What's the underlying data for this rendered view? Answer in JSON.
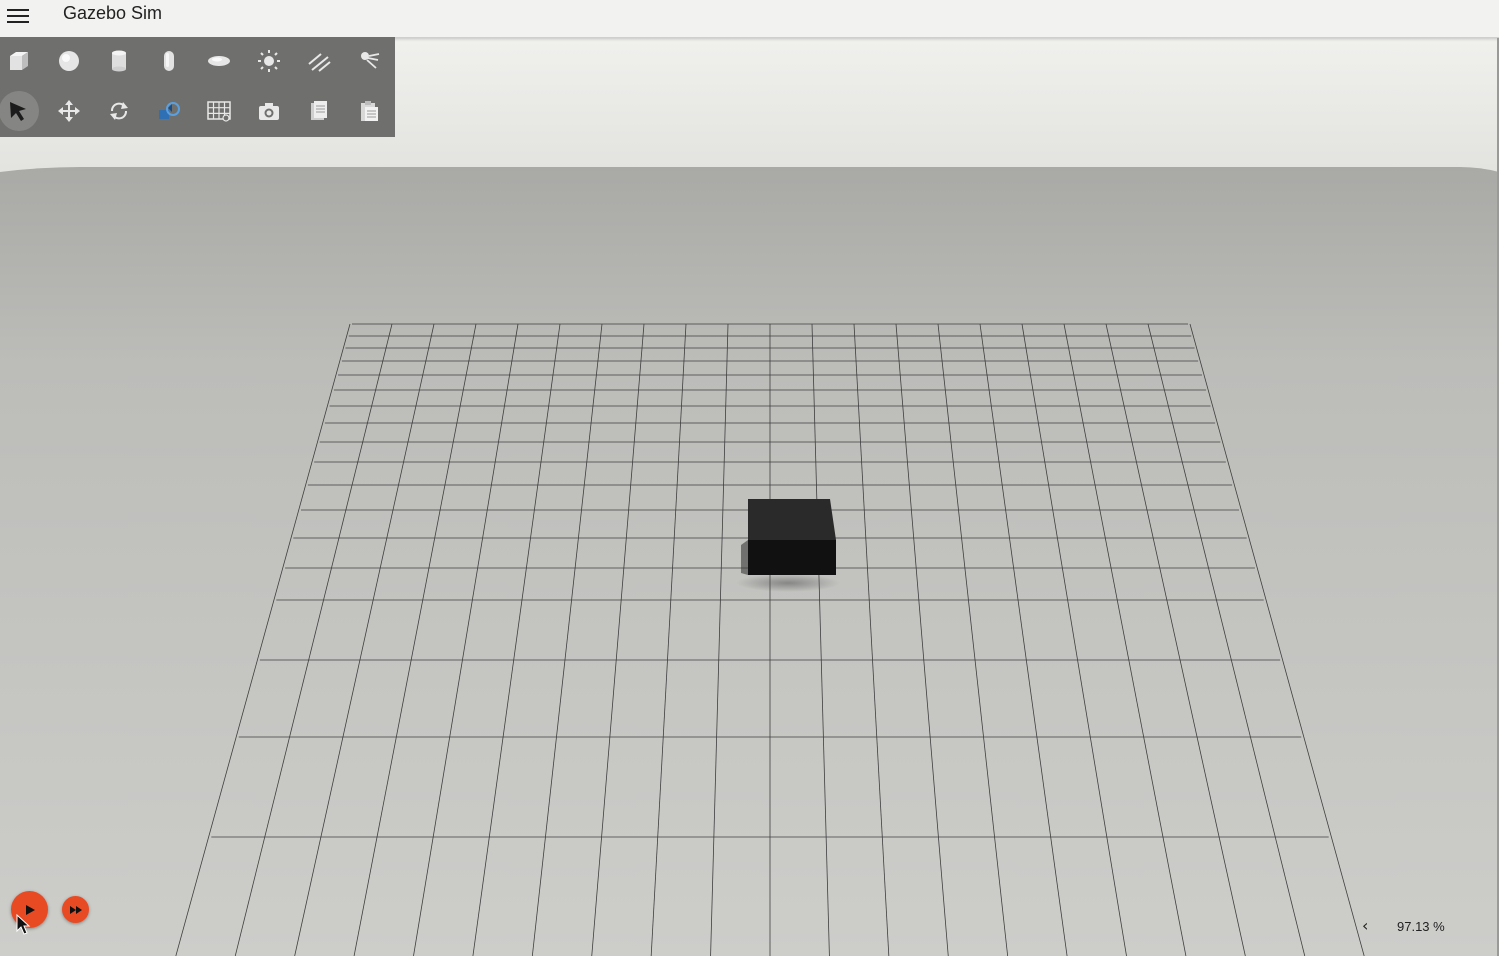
{
  "window": {
    "title": "Gazebo Sim"
  },
  "toolbar": {
    "row1": [
      {
        "icon": "box-shape-icon"
      },
      {
        "icon": "sphere-shape-icon"
      },
      {
        "icon": "cylinder-shape-icon"
      },
      {
        "icon": "capsule-shape-icon"
      },
      {
        "icon": "ellipsoid-shape-icon"
      },
      {
        "icon": "point-light-icon"
      },
      {
        "icon": "directional-light-icon"
      },
      {
        "icon": "spot-light-icon"
      }
    ],
    "row2": [
      {
        "icon": "select-arrow-icon",
        "selected": true
      },
      {
        "icon": "translate-icon"
      },
      {
        "icon": "rotate-icon"
      },
      {
        "icon": "transform-control-icon"
      },
      {
        "icon": "grid-snap-icon"
      },
      {
        "icon": "screenshot-camera-icon"
      },
      {
        "icon": "copy-icon"
      },
      {
        "icon": "paste-icon"
      }
    ]
  },
  "world_control": {
    "play_icon": "play-icon",
    "step_icon": "fast-forward-icon",
    "accent_color": "#e84a24"
  },
  "stats": {
    "toggle_glyph": "‹",
    "real_time_factor": "97.13 %"
  },
  "colors": {
    "sky": "#e8e8e5",
    "ground": "#c9c9c6",
    "grid_line": "#3a3a3a",
    "toolbar": "#6f706d",
    "box": "#1b1b1b"
  }
}
